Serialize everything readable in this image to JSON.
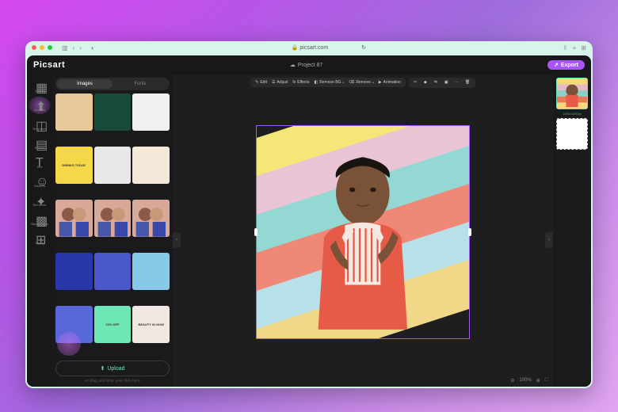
{
  "browser": {
    "url": "picsart.com"
  },
  "header": {
    "logo": "Picsart",
    "project": "Project 87",
    "export": "Export"
  },
  "sidebar": {
    "items": [
      {
        "id": "layout",
        "label": "Layout"
      },
      {
        "id": "uploads",
        "label": "Uploads"
      },
      {
        "id": "templates",
        "label": "Templates"
      },
      {
        "id": "photos",
        "label": "Photos"
      },
      {
        "id": "text",
        "label": "Text"
      },
      {
        "id": "stickers",
        "label": "Stickers"
      },
      {
        "id": "elements",
        "label": "Elements"
      },
      {
        "id": "background",
        "label": "Background"
      },
      {
        "id": "batch",
        "label": "Batch"
      }
    ]
  },
  "panel": {
    "tabs": [
      {
        "label": "Images"
      },
      {
        "label": "Fonts"
      }
    ],
    "upload_label": "Upload",
    "drag_hint": "or drag and drop your files here",
    "thumbs": [
      {
        "bg": "#e8c898"
      },
      {
        "bg": "#1a4a3a"
      },
      {
        "bg": "#f0f0f0"
      },
      {
        "bg": "#f5d848",
        "txt": "DRINKS TODAY"
      },
      {
        "bg": "#e8e8e8"
      },
      {
        "bg": "#f5e8d8"
      },
      {
        "bg": "#d8a898"
      },
      {
        "bg": "#d8a898"
      },
      {
        "bg": "#d8a898"
      },
      {
        "bg": "#2838a8"
      },
      {
        "bg": "#4858c8"
      },
      {
        "bg": "#88c8e8"
      },
      {
        "bg": "#5868d8"
      },
      {
        "bg": "#6ee7b7",
        "txt": "20% OFF"
      },
      {
        "bg": "#f0e8e0",
        "txt": "BEAUTY IN NOW"
      }
    ]
  },
  "toolbar": {
    "edit": "Edit",
    "adjust": "Adjust",
    "effects": "Effects",
    "removebg": "Remove BG",
    "remove": "Remove",
    "animation": "Animation"
  },
  "status": {
    "zoom": "100%"
  },
  "right": {
    "dimensions": "1080x1080px"
  },
  "canvas": {
    "stripes": [
      "#f5e678",
      "#e8c4d4",
      "#94d8d4",
      "#f08878",
      "#b8e0e8",
      "#f0d888"
    ]
  }
}
